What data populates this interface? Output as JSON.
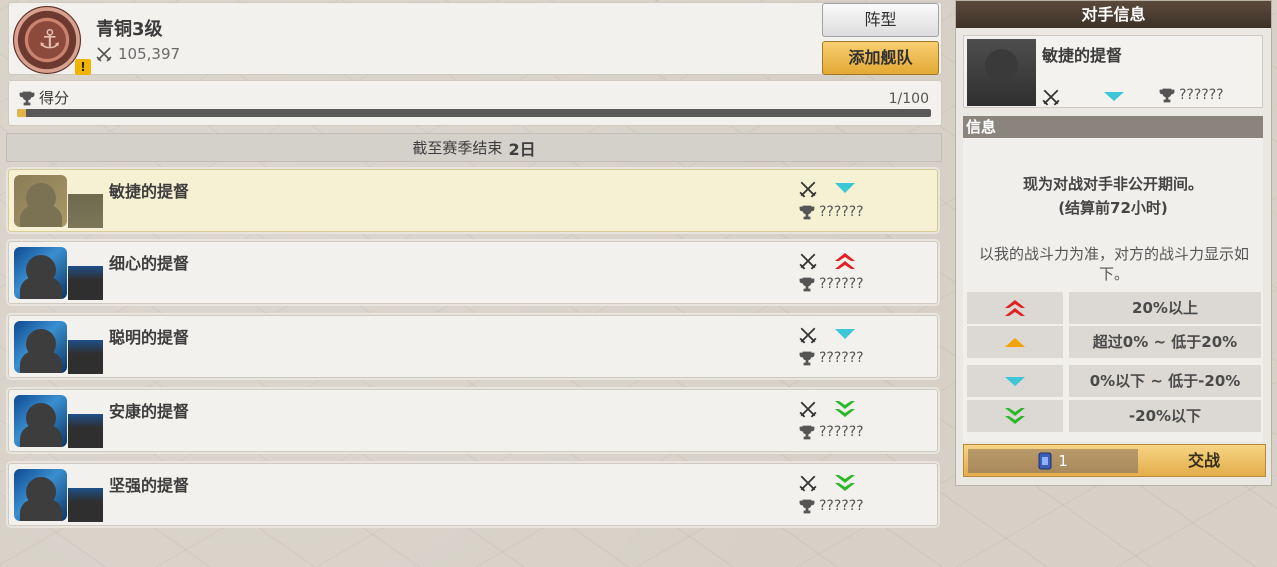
{
  "player": {
    "rank": "青铜3级",
    "power": "105,397",
    "warning_badge": "!",
    "icons": {
      "medal": "anchor-medal-icon",
      "power": "crossed-swords-icon",
      "warning": "warning-icon"
    }
  },
  "buttons": {
    "formation": "阵型",
    "add_fleet": "添加舰队"
  },
  "score": {
    "label": "得分",
    "value": "1/100",
    "progress": 0.01
  },
  "season": {
    "prefix": "截至赛季结束",
    "days": "2日"
  },
  "opponents": [
    {
      "name": "敏捷的提督",
      "trophy": "??????",
      "trend": "down-small",
      "selected": true
    },
    {
      "name": "细心的提督",
      "trophy": "??????",
      "trend": "up-large",
      "selected": false
    },
    {
      "name": "聪明的提督",
      "trophy": "??????",
      "trend": "down-small",
      "selected": false
    },
    {
      "name": "安康的提督",
      "trophy": "??????",
      "trend": "down-large",
      "selected": false
    },
    {
      "name": "坚强的提督",
      "trophy": "??????",
      "trend": "down-large",
      "selected": false
    }
  ],
  "panel": {
    "title": "对手信息",
    "opponent_name": "敏捷的提督",
    "opponent_trophy": "??????",
    "info_header": "信息",
    "info_line1": "现为对战对手非公开期间。",
    "info_line2": "(结算前72小时)",
    "info_desc": "以我的战斗力为准，对方的战斗力显示如下。",
    "legend": [
      {
        "label": "20%以上",
        "icon": "double-up-red"
      },
      {
        "label": "超过0% ~ 低于20%",
        "icon": "up-orange"
      },
      {
        "label": "0%以下 ~ 低于-20%",
        "icon": "down-cyan"
      },
      {
        "label": "-20%以下",
        "icon": "double-down-green"
      }
    ],
    "ticket_count": "1",
    "fight_label": "交战"
  },
  "colors": {
    "red": "#e02222",
    "orange": "#f5a20a",
    "cyan": "#3cc6d8",
    "green": "#2fb72c",
    "gold": "#e4ad4a"
  }
}
